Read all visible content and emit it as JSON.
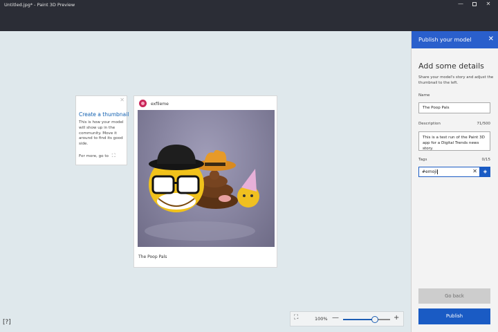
{
  "window": {
    "title": "Untitled.jpg* - Paint 3D Preview",
    "minimize_glyph": "—",
    "close_glyph": "✕"
  },
  "tip": {
    "title": "Create a thumbnail",
    "body": "This is how your model will show up in the community. Move it around to find its good side.",
    "more": "For more, go to",
    "close_glyph": "✕",
    "icon_glyph": "⛶"
  },
  "post": {
    "username": "exfileme",
    "caption": "The Poop Pals"
  },
  "zoom": {
    "level": "100%",
    "slider_value": 0.68,
    "fit_glyph": "⛶",
    "minus": "—",
    "plus": "+"
  },
  "help_glyph": "[?]",
  "panel": {
    "header": "Publish your model",
    "close_glyph": "✕",
    "heading": "Add some details",
    "subtitle": "Share your model's story and adjust the thumbnail to the left.",
    "name_label": "Name",
    "name_value": "The Poop Pals",
    "description_label": "Description",
    "description_count": "71/500",
    "description_value": "This is a test run of the Paint 3D app for a Digital Trends news story.",
    "tags_label": "Tags",
    "tags_count": "0/15",
    "tags_value": "#emoji",
    "tag_clear_glyph": "✕",
    "tag_add_glyph": "◈",
    "go_back_label": "Go back",
    "publish_label": "Publish"
  },
  "colors": {
    "accent": "#1a5bc4",
    "titlebar": "#2b2d36",
    "canvas": "#dfe8ec"
  }
}
